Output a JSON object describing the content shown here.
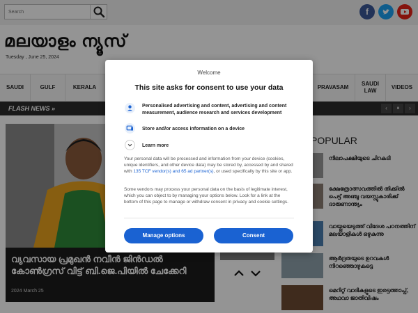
{
  "colors": {
    "brand_dark": "#2b2b2b",
    "consent_blue": "#1a62d2",
    "facebook": "#3b5998",
    "twitter": "#1da1f2",
    "youtube": "#e62117"
  },
  "search": {
    "placeholder": "Search",
    "icon": "search-icon"
  },
  "social": {
    "facebook_icon": "facebook-icon",
    "twitter_icon": "twitter-icon",
    "youtube_icon": "youtube-icon"
  },
  "masthead": {
    "logo": "മലയാളം ന്യൂസ്",
    "date": "Tuesday , June   25, 2024"
  },
  "nav": {
    "items": [
      "SAUDI",
      "GULF",
      "KERALA",
      "PRAVASAM",
      "SAUDI LAW",
      "VIDEOS"
    ]
  },
  "flash": {
    "label": "FLASH NEWS »",
    "prev": "‹",
    "pause": "⏸",
    "next": "›"
  },
  "hero": {
    "title": "വ്യവസായ പ്രമുഖൻ നവീൻ ജിൻഡൽ കോൺഗ്രസ് വിട്ട് ബി.ജെ.പിയിൽ ചേക്കേറി",
    "date": "2024 March 25"
  },
  "popular": {
    "heading": "POPULAR",
    "items": [
      {
        "title": "നിലാപക്ഷിയുടെ ചിറകടി"
      },
      {
        "title": "ക്ഷേത്രോത്സവത്തിൽ തിക്കിൽ പെട്ട് അഞ്ചു വയസ്സുകാരിക്ക് ദാരുണാന്ത്യം"
      },
      {
        "title": "വായ്പ്പയെടുത്ത് വിദേശ പഠനത്തിന് മലയാളികൾ ഒഴുകുന്നു"
      },
      {
        "title": "ആർദ്രതയുടെ ഉറവകൾ നിറഞ്ഞൊഴുകട്ടെ"
      },
      {
        "title": "മെറിറ്റ് വാദികളുടെ ഇരട്ടത്താപ്പ്, അഥവാ ജാതിവിഷം"
      }
    ]
  },
  "consent": {
    "welcome": "Welcome",
    "title": "This site asks for consent to use your data",
    "purposes": [
      {
        "icon": "user-icon",
        "text": "Personalised advertising and content, advertising and content measurement, audience research and services development"
      },
      {
        "icon": "device-icon",
        "text": "Store and/or access information on a device"
      },
      {
        "icon": "chevron-down-icon",
        "text": "Learn more"
      }
    ],
    "para1_a": "Your personal data will be processed and information from your device (cookies, unique identifiers, and other device data) may be stored by, accessed by and shared with ",
    "para1_link": "135 TCF vendor(s) and 65 ad partner(s)",
    "para1_b": ", or used specifically by this site or app.",
    "para2": "Some vendors may process your personal data on the basis of legitimate interest, which you can object to by managing your options below. Look for a link at the bottom of this page to manage or withdraw consent in privacy and cookie settings.",
    "manage_label": "Manage options",
    "consent_label": "Consent"
  }
}
